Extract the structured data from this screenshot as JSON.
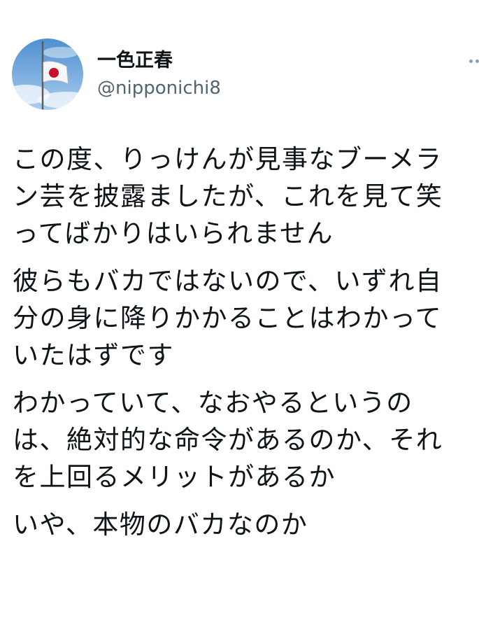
{
  "author": {
    "display_name": "一色正春",
    "handle": "@nipponichi8",
    "avatar_icon": "japanese-flag-avatar-icon"
  },
  "more_icon": "more-dots-icon",
  "tweet": {
    "paragraphs": [
      "この度、りっけんが見事なブーメラ\nン芸を披露ましたが、これを見て笑\nってばかりはいられません",
      "彼らもバカではないので、いずれ自\n分の身に降りかかることはわかって\nいたはずです",
      "わかっていて、なおやるというの\nは、絶対的な命令があるのか、それ\nを上回るメリットがあるか",
      "いや、本物のバカなのか"
    ]
  },
  "colors": {
    "text": "#0f1419",
    "secondary_text": "#536471",
    "sky": "#7fb3e0",
    "flag_red": "#c8102e"
  }
}
